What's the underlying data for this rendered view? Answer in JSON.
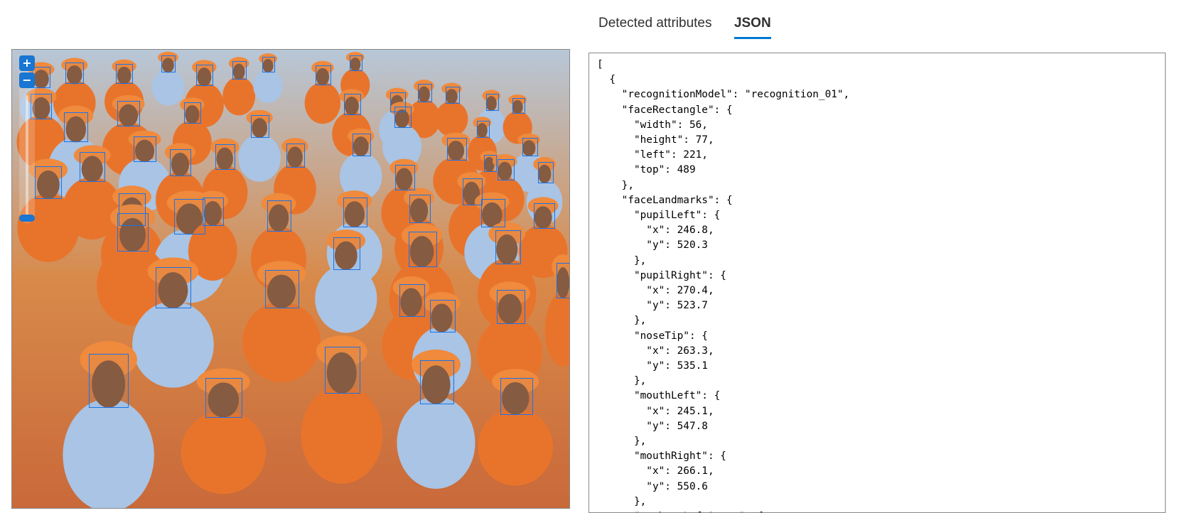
{
  "tabs": [
    {
      "label": "Detected attributes",
      "active": false
    },
    {
      "label": "JSON",
      "active": true
    }
  ],
  "image_viewer": {
    "zoom_in_label": "+",
    "zoom_out_label": "−",
    "accent_color": "#1a73e8",
    "faces_detected_boxes": 60
  },
  "json_output": "[\n  {\n    \"recognitionModel\": \"recognition_01\",\n    \"faceRectangle\": {\n      \"width\": 56,\n      \"height\": 77,\n      \"left\": 221,\n      \"top\": 489\n    },\n    \"faceLandmarks\": {\n      \"pupilLeft\": {\n        \"x\": 246.8,\n        \"y\": 520.3\n      },\n      \"pupilRight\": {\n        \"x\": 270.4,\n        \"y\": 523.7\n      },\n      \"noseTip\": {\n        \"x\": 263.3,\n        \"y\": 535.1\n      },\n      \"mouthLeft\": {\n        \"x\": 245.1,\n        \"y\": 547.8\n      },\n      \"mouthRight\": {\n        \"x\": 266.1,\n        \"y\": 550.6\n      },\n      \"eyebrowLeftOuter\": {",
  "colors": {
    "tab_underline": "#0078d4",
    "face_box": "#1a73e8",
    "vest_orange": "#e8742c",
    "shirt_blue": "#a9c4e4"
  }
}
